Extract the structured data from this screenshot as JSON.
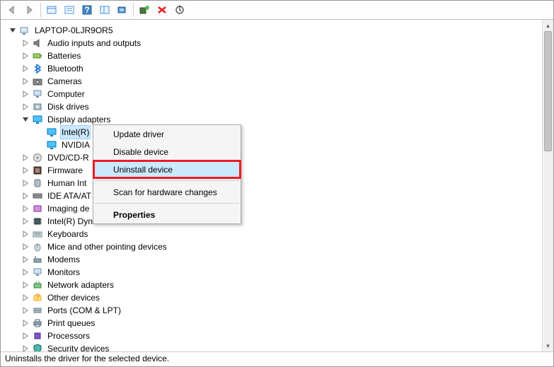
{
  "toolbar": {
    "buttons": [
      {
        "name": "back-icon"
      },
      {
        "name": "forward-icon"
      },
      {
        "sep": true
      },
      {
        "name": "show-hidden-icon"
      },
      {
        "name": "find-icon"
      },
      {
        "name": "help-icon"
      },
      {
        "name": "properties-icon"
      },
      {
        "name": "update-driver-icon"
      },
      {
        "sep": true
      },
      {
        "name": "add-hardware-icon"
      },
      {
        "name": "uninstall-icon"
      },
      {
        "name": "scan-icon"
      }
    ]
  },
  "tree": {
    "root": {
      "label": "LAPTOP-0LJR9OR5",
      "expanded": true
    },
    "items": [
      {
        "label": "Audio inputs and outputs",
        "icon": "speaker-icon"
      },
      {
        "label": "Batteries",
        "icon": "battery-icon"
      },
      {
        "label": "Bluetooth",
        "icon": "bluetooth-icon"
      },
      {
        "label": "Cameras",
        "icon": "camera-icon"
      },
      {
        "label": "Computer",
        "icon": "computer-icon"
      },
      {
        "label": "Disk drives",
        "icon": "disk-icon"
      },
      {
        "label": "Display adapters",
        "icon": "display-icon",
        "expanded": true,
        "children": [
          {
            "label": "Intel(R)",
            "icon": "display-icon",
            "selected": true
          },
          {
            "label": "NVIDIA",
            "icon": "display-icon"
          }
        ]
      },
      {
        "label": "DVD/CD-R",
        "icon": "optical-icon"
      },
      {
        "label": "Firmware",
        "icon": "firmware-icon"
      },
      {
        "label": "Human Int",
        "icon": "hid-icon"
      },
      {
        "label": "IDE ATA/AT",
        "icon": "ide-icon"
      },
      {
        "label": "Imaging de",
        "icon": "imaging-icon"
      },
      {
        "label": "Intel(R) Dynamic Platform and Thermal Framework",
        "icon": "chip-icon"
      },
      {
        "label": "Keyboards",
        "icon": "keyboard-icon"
      },
      {
        "label": "Mice and other pointing devices",
        "icon": "mouse-icon"
      },
      {
        "label": "Modems",
        "icon": "modem-icon"
      },
      {
        "label": "Monitors",
        "icon": "monitor-icon"
      },
      {
        "label": "Network adapters",
        "icon": "network-icon"
      },
      {
        "label": "Other devices",
        "icon": "other-icon"
      },
      {
        "label": "Ports (COM & LPT)",
        "icon": "port-icon"
      },
      {
        "label": "Print queues",
        "icon": "printer-icon"
      },
      {
        "label": "Processors",
        "icon": "cpu-icon"
      },
      {
        "label": "Security devices",
        "icon": "security-icon"
      }
    ]
  },
  "context_menu": {
    "items": [
      {
        "label": "Update driver"
      },
      {
        "label": "Disable device"
      },
      {
        "label": "Uninstall device",
        "highlight": true,
        "redbox": true
      },
      {
        "sep": true
      },
      {
        "label": "Scan for hardware changes"
      },
      {
        "sep": true
      },
      {
        "label": "Properties",
        "bold": true
      }
    ]
  },
  "status": {
    "text": "Uninstalls the driver for the selected device."
  }
}
